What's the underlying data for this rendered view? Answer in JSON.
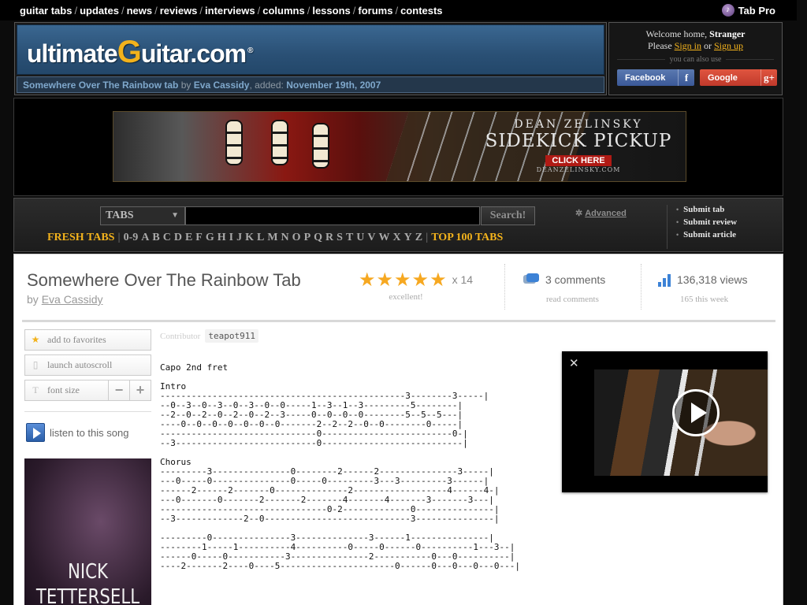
{
  "topnav": {
    "links": [
      "guitar tabs",
      "updates",
      "news",
      "reviews",
      "interviews",
      "columns",
      "lessons",
      "forums",
      "contests"
    ],
    "tab_pro": "Tab Pro"
  },
  "header": {
    "logo_pre": "ultimate",
    "logo_g": "G",
    "logo_post": "uitar.com",
    "logo_reg": "®",
    "breadcrumb": {
      "song": "Somewhere Over The Rainbow tab",
      "by": "by",
      "artist": "Eva Cassidy",
      "added_label": ", added:",
      "date": "November 19th, 2007"
    }
  },
  "login": {
    "welcome": "Welcome home,",
    "user": "Stranger",
    "please": "Please",
    "sign_in": "Sign in",
    "or": "or",
    "sign_up": "Sign up",
    "also": "you can also use",
    "facebook": "Facebook",
    "facebook_icon": "f",
    "google": "Google",
    "google_icon": "g+"
  },
  "ad": {
    "line1": "DEAN ZELINSKY",
    "line2": "SIDEKICK PICKUP",
    "cta": "CLICK HERE",
    "url": "DEANZELINSKY.COM"
  },
  "search": {
    "type_selected": "TABS",
    "query": "",
    "button": "Search!",
    "advanced": "Advanced",
    "fresh": "FRESH TABS",
    "letters": [
      "0-9",
      "A",
      "B",
      "C",
      "D",
      "E",
      "F",
      "G",
      "H",
      "I",
      "J",
      "K",
      "L",
      "M",
      "N",
      "O",
      "P",
      "Q",
      "R",
      "S",
      "T",
      "U",
      "V",
      "W",
      "X",
      "Y",
      "Z"
    ],
    "top100": "TOP 100 TABS",
    "submit": [
      "Submit tab",
      "Submit review",
      "Submit article"
    ]
  },
  "song": {
    "title": "Somewhere Over The Rainbow Tab",
    "by": "by",
    "artist": "Eva Cassidy",
    "rating_count": "x 14",
    "rating_stars": 5,
    "rating_word": "excellent!",
    "comments": "3 comments",
    "comments_sub": "read comments",
    "views": "136,318 views",
    "views_sub": "165 this week"
  },
  "sidebar": {
    "favorites": "add to favorites",
    "autoscroll": "launch autoscroll",
    "font_size": "font size",
    "font_minus": "−",
    "font_plus": "+",
    "listen": "listen to this song",
    "poster_line1": "NICK",
    "poster_line2": "TETTERSELL"
  },
  "tab": {
    "contributor_label": "Contributor",
    "contributor": "teapot911",
    "body": "Capo 2nd fret\n\nIntro\n-----------------------------------------------3--------3-----|\n--0--3--0--3--0--3--0--0-----1--3--1--3---------5--------|\n--2--0--2--0--2--0--2--3-----0--0--0--0--------5--5--5---|\n----0--0--0--0--0--0--0-------2--2--2--0--0--------0-----|\n------------------------------0-------------------------0-|\n--3---------------------------0---------------------------|\n\nChorus\n---------3---------------0--------2------2---------------3-----|\n---0-----0---------------0-----0---------3---3---------3------|\n------2------2-------0--------------2------------------4------4-|\n---0-------0-------2-------2-------4-------4-------3-------3---|\n--------------------------------0-2-------------0---------------|\n--3-------------2--0----------------------------3---------------|\n\n---------0---------------3--------------3------1---------------|\n--------1-----1----------4----------0-----0------0----------1---3--|\n------0-----0-----------3---------------2-----------0---0----------|\n----2-------2----0----5----------------------0------0---0---0---0---|"
  },
  "colors": {
    "accent_gold": "#f2b21c",
    "header_blue": "#2a5075",
    "link_blue": "#7fa8cc",
    "star_orange": "#f6a821"
  }
}
